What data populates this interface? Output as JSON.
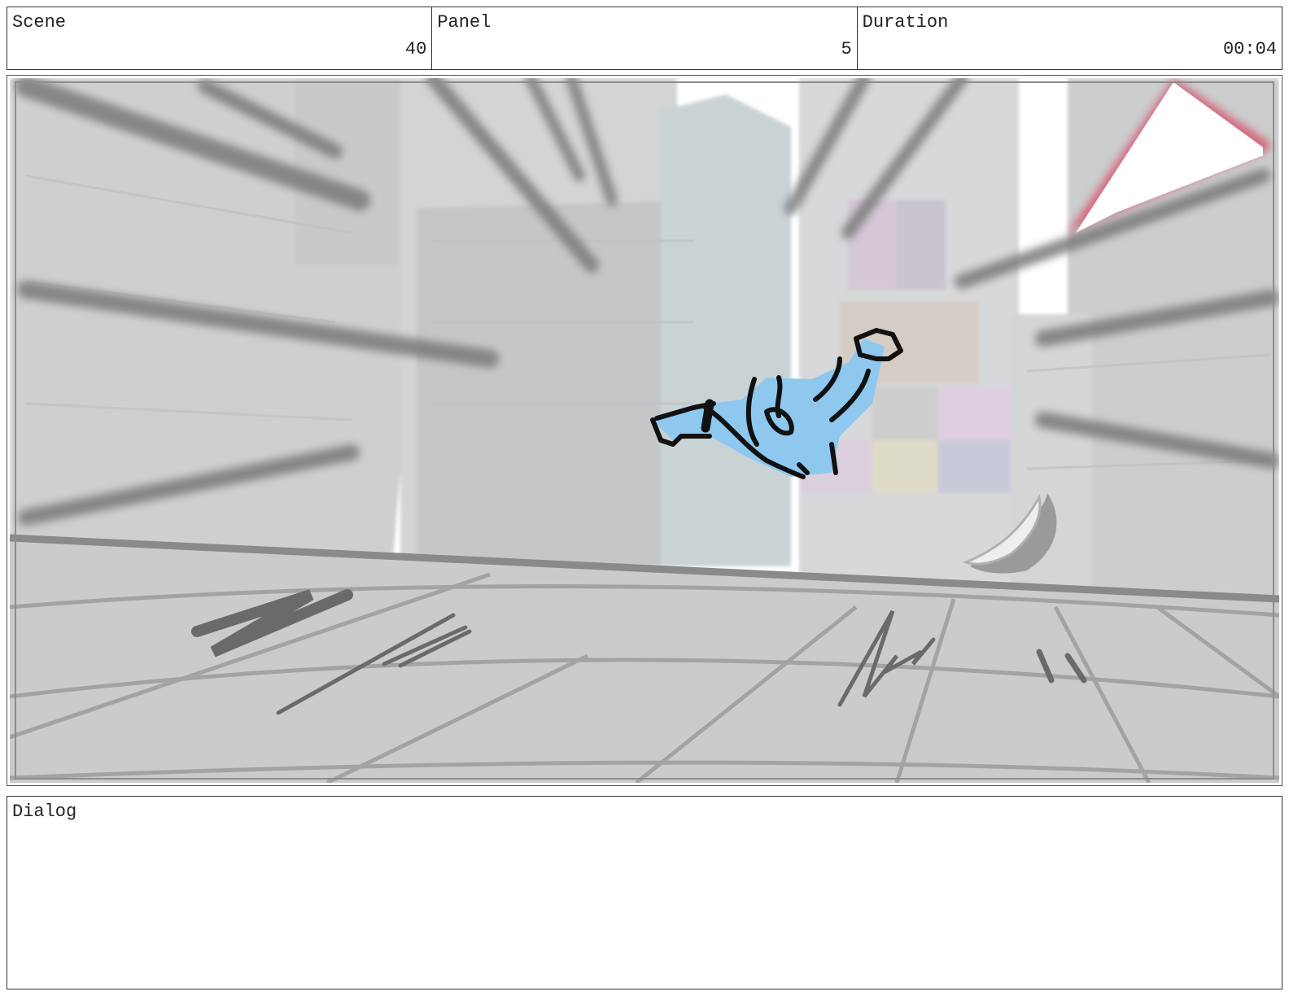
{
  "header": {
    "scene": {
      "label": "Scene",
      "value": "40"
    },
    "panel": {
      "label": "Panel",
      "value": "5"
    },
    "duration": {
      "label": "Duration",
      "value": "00:04"
    }
  },
  "dialog": {
    "label": "Dialog",
    "text": ""
  },
  "colors": {
    "character_fill": "#8ec8ef",
    "slash_accent": "#d9405f",
    "sketch_gray": "#9a9a9a"
  }
}
